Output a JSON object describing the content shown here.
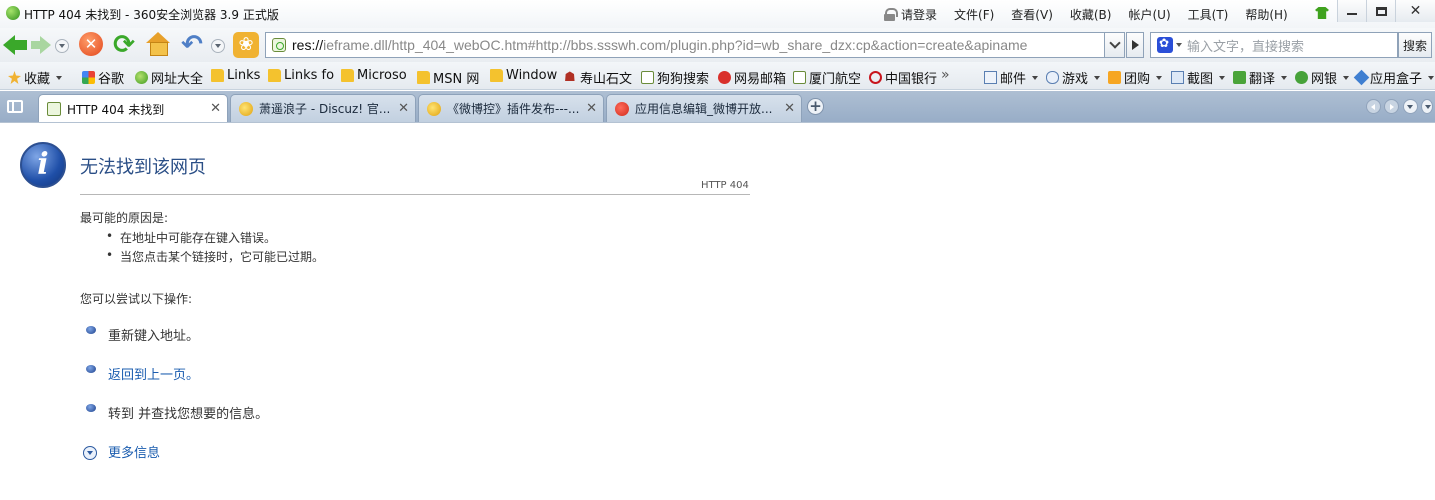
{
  "window": {
    "title": "HTTP 404 未找到 - 360安全浏览器 3.9 正式版"
  },
  "menu": {
    "login": "请登录",
    "file": "文件(F)",
    "view": "查看(V)",
    "favorites": "收藏(B)",
    "account": "帐户(U)",
    "tools": "工具(T)",
    "help": "帮助(H)"
  },
  "navbar": {
    "url_scheme": "res://",
    "url_rest": "ieframe.dll/http_404_webOC.htm#http://bbs.ssswh.com/plugin.php?id=wb_share_dzx:cp&action=create&apiname",
    "search_placeholder": "输入文字，直接搜索",
    "search_button": "搜索"
  },
  "bookmarks": {
    "favorites": "收藏",
    "items": [
      "谷歌",
      "网址大全",
      "Links",
      "Links fo",
      "Microso",
      "MSN 网",
      "Window",
      "寿山石文",
      "狗狗搜索",
      "网易邮箱",
      "厦门航空",
      "中国银行"
    ],
    "more": "»",
    "tools": [
      "邮件",
      "游戏",
      "团购",
      "截图",
      "翻译",
      "网银",
      "应用盒子"
    ]
  },
  "tabs": [
    {
      "title": "HTTP 404 未找到",
      "active": true
    },
    {
      "title": "萧遥浪子 - Discuz! 官...",
      "active": false
    },
    {
      "title": "《微博控》插件发布---...",
      "active": false
    },
    {
      "title": "应用信息编辑_微博开放...",
      "active": false
    }
  ],
  "page": {
    "title": "无法找到该网页",
    "code": "HTTP 404",
    "causes_heading": "最可能的原因是:",
    "causes": [
      "在地址中可能存在键入错误。",
      "当您点击某个链接时，它可能已过期。"
    ],
    "try_heading": "您可以尝试以下操作:",
    "actions": [
      "重新键入地址。",
      "返回到上一页。",
      "转到  并查找您想要的信息。"
    ],
    "more_info": "更多信息"
  }
}
